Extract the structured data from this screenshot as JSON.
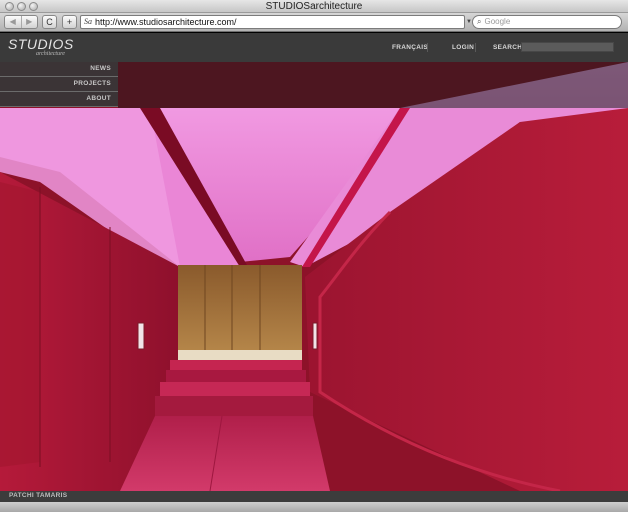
{
  "window": {
    "title": "STUDIOSarchitecture"
  },
  "toolbar": {
    "back_label": "◀",
    "forward_label": "▶",
    "reload_label": "C",
    "add_label": "+",
    "address_value": "http://www.studiosarchitecture.com/",
    "favicon": "Sa",
    "search_placeholder": "Google"
  },
  "site": {
    "logo_main": "STUDIOS",
    "logo_sub": "architecture",
    "header_links": [
      "FRANÇAIS",
      "LOGIN",
      "SEARCH"
    ],
    "search_value": "",
    "sidebar_items": [
      "NEWS",
      "PROJECTS",
      "ABOUT"
    ],
    "photo_credit": "PATCHI TAMARIS"
  },
  "colors": {
    "header_bg": "#3a3a3a",
    "ceiling_glow": "#f07ad4",
    "wall_red": "#a8142e",
    "floor_pink": "#c92a5c",
    "wood": "#a0713b"
  }
}
